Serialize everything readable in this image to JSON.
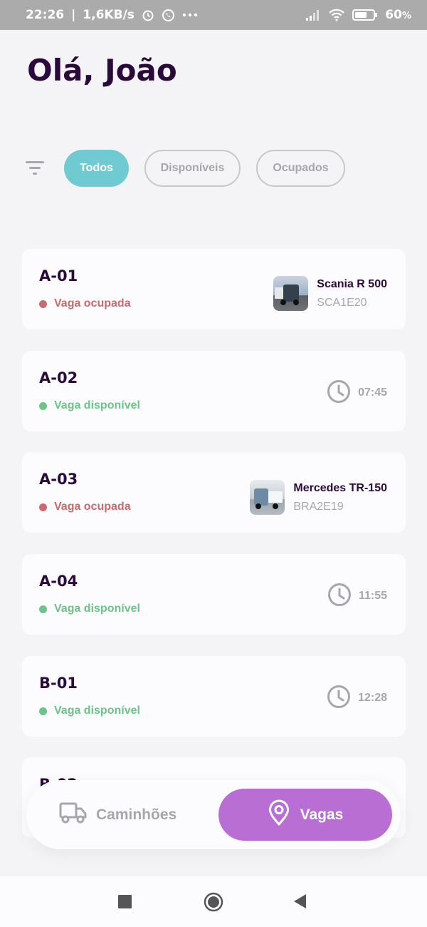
{
  "status_bar": {
    "time": "22:26",
    "speed": "1,6KB/s",
    "battery": "60",
    "battery_unit": "%",
    "icons": [
      "alarm-icon",
      "whatsapp-icon",
      "more-icon",
      "signal-icon",
      "wifi-icon",
      "battery-icon"
    ]
  },
  "header": {
    "greeting": "Olá, João"
  },
  "filters": {
    "icon": "filter-icon",
    "chips": [
      {
        "label": "Todos",
        "active": true
      },
      {
        "label": "Disponíveis",
        "active": false
      },
      {
        "label": "Ocupados",
        "active": false
      }
    ]
  },
  "spots": [
    {
      "code": "A-01",
      "status": "Vaga ocupada",
      "occupied": true,
      "truck_model": "Scania R 500",
      "plate": "SCA1E20"
    },
    {
      "code": "A-02",
      "status": "Vaga disponível",
      "occupied": false,
      "time": "07:45"
    },
    {
      "code": "A-03",
      "status": "Vaga ocupada",
      "occupied": true,
      "truck_model": "Mercedes TR-150",
      "plate": "BRA2E19"
    },
    {
      "code": "A-04",
      "status": "Vaga disponível",
      "occupied": false,
      "time": "11:55"
    },
    {
      "code": "B-01",
      "status": "Vaga disponível",
      "occupied": false,
      "time": "12:28"
    },
    {
      "code": "B-02"
    }
  ],
  "bottom_nav": {
    "items": [
      {
        "label": "Caminhões",
        "icon": "truck-icon",
        "active": false
      },
      {
        "label": "Vagas",
        "icon": "map-pin-icon",
        "active": true
      }
    ]
  },
  "system_nav": {
    "icons": [
      "recents-icon",
      "home-icon",
      "back-icon"
    ]
  },
  "colors": {
    "accent_teal": "#6fcbd1",
    "accent_purple": "#b86ed3",
    "occupied_red": "#c96a6d",
    "available_green": "#6cc488",
    "heading": "#2a0a3a"
  }
}
